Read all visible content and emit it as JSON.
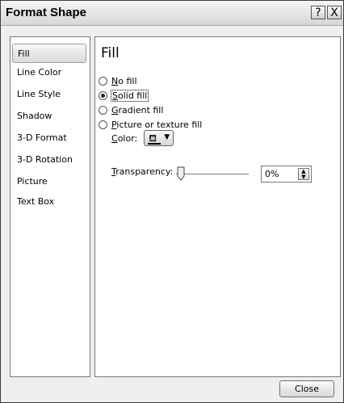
{
  "window": {
    "title": "Format Shape",
    "help_glyph": "?",
    "close_glyph": "X"
  },
  "sidebar": {
    "items": [
      {
        "label": "Fill",
        "selected": true
      },
      {
        "label": "Line Color"
      },
      {
        "label": "Line Style"
      },
      {
        "label": "Shadow"
      },
      {
        "label": "3-D Format"
      },
      {
        "label": "3-D Rotation"
      },
      {
        "label": "Picture"
      },
      {
        "label": "Text Box"
      }
    ]
  },
  "panel": {
    "heading": "Fill",
    "options": [
      {
        "mnemonic": "N",
        "rest": "o fill",
        "selected": false
      },
      {
        "mnemonic": "S",
        "rest": "olid fill",
        "selected": true
      },
      {
        "mnemonic": "G",
        "rest": "radient fill",
        "selected": false
      },
      {
        "mnemonic": "P",
        "rest": "icture or texture fill",
        "selected": false
      }
    ],
    "color": {
      "mnemonic": "C",
      "rest": "olor:",
      "icon": "paint-bucket-icon",
      "swatch_color": "#000000"
    },
    "transparency": {
      "mnemonic": "T",
      "rest": "ransparency:",
      "value": "0%",
      "slider_value": 0
    }
  },
  "footer": {
    "close_label": "Close"
  }
}
